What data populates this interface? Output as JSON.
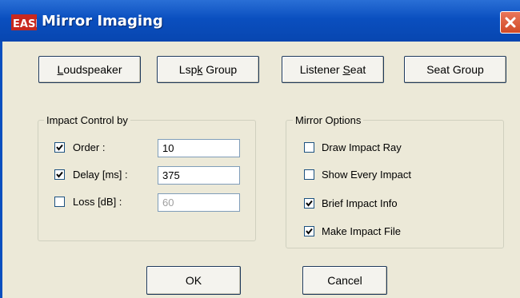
{
  "window": {
    "title": "Mirror Imaging",
    "icon": "ease-app-icon"
  },
  "top_buttons": [
    {
      "label": "Loudspeaker",
      "mnemonic_index": 0
    },
    {
      "label": "Lspk Group",
      "mnemonic_index": 3
    },
    {
      "label": "Listener Seat",
      "mnemonic_index": 9
    },
    {
      "label": "Seat Group",
      "mnemonic_index": -1
    }
  ],
  "impact_control": {
    "legend": "Impact Control by",
    "rows": [
      {
        "label": "Order :",
        "checked": true,
        "value": "10",
        "enabled": true
      },
      {
        "label": "Delay [ms] :",
        "checked": true,
        "value": "375",
        "enabled": true
      },
      {
        "label": "Loss [dB] :",
        "checked": false,
        "value": "60",
        "enabled": false
      }
    ]
  },
  "mirror_options": {
    "legend": "Mirror Options",
    "items": [
      {
        "label": "Draw Impact Ray",
        "checked": false
      },
      {
        "label": "Show Every Impact",
        "checked": false
      },
      {
        "label": "Brief Impact Info",
        "checked": true
      },
      {
        "label": "Make Impact File",
        "checked": true
      }
    ]
  },
  "footer": {
    "ok_label": "OK",
    "cancel_label": "Cancel"
  },
  "colors": {
    "titlebar": "#0a4fbf",
    "close_button": "#d24a26",
    "dialog_bg": "#ece9d8"
  }
}
